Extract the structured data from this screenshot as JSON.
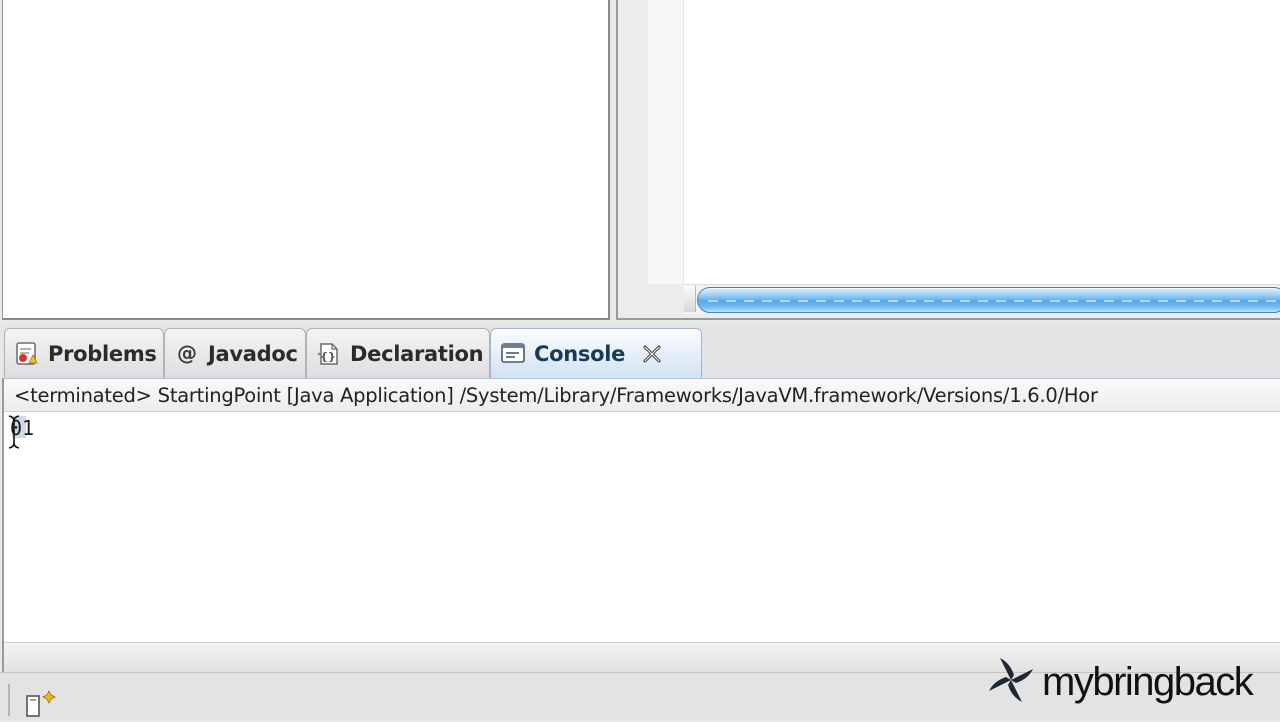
{
  "console_tabs": [
    {
      "label": "Problems",
      "icon": "problems-icon"
    },
    {
      "label": "Javadoc",
      "icon": "at-icon"
    },
    {
      "label": "Declaration",
      "icon": "declaration-icon"
    },
    {
      "label": "Console",
      "icon": "console-icon",
      "active": true
    }
  ],
  "console": {
    "header": "<terminated> StartingPoint [Java Application] /System/Library/Frameworks/JavaVM.framework/Versions/1.6.0/Hor",
    "output": "01"
  },
  "watermark": {
    "text": "mybringback"
  },
  "colors": {
    "scrollbar_thumb": "#55a8e8",
    "active_tab": "#e4eef8",
    "watermark": "#111111"
  }
}
